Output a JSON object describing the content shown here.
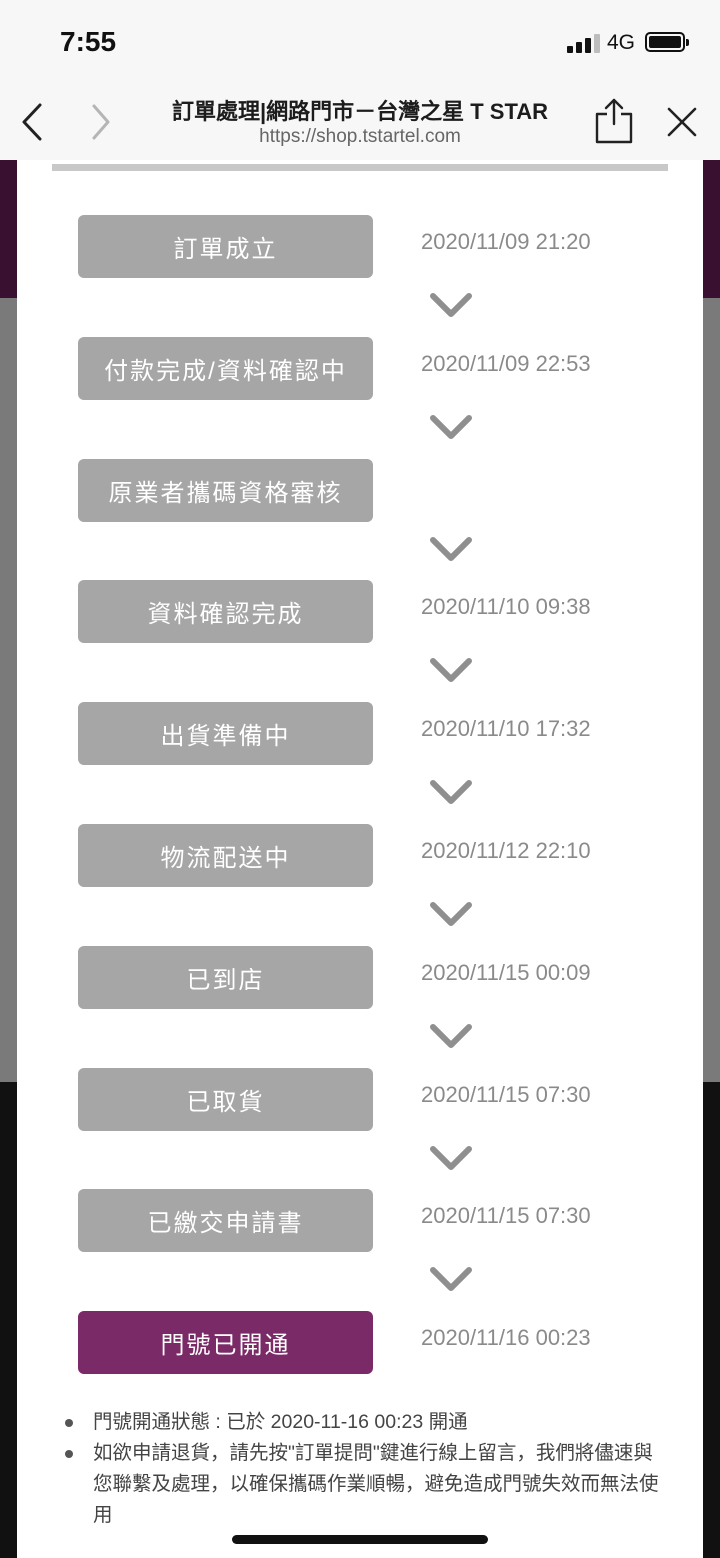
{
  "status_bar": {
    "time": "7:55",
    "network": "4G"
  },
  "browser": {
    "title": "訂單處理|網路門市－台灣之星 T STAR",
    "url": "https://shop.tstartel.com",
    "icons": [
      "chevron-left-icon",
      "chevron-right-icon",
      "share-icon",
      "close-icon"
    ]
  },
  "timeline": {
    "steps": [
      {
        "label": "訂單成立",
        "time": "2020/11/09 21:20"
      },
      {
        "label": "付款完成/資料確認中",
        "time": "2020/11/09 22:53"
      },
      {
        "label": "原業者攜碼資格審核",
        "time": ""
      },
      {
        "label": "資料確認完成",
        "time": "2020/11/10 09:38"
      },
      {
        "label": "出貨準備中",
        "time": "2020/11/10 17:32"
      },
      {
        "label": "物流配送中",
        "time": "2020/11/12 22:10"
      },
      {
        "label": "已到店",
        "time": "2020/11/15 00:09"
      },
      {
        "label": "已取貨",
        "time": "2020/11/15 07:30"
      },
      {
        "label": "已繳交申請書",
        "time": "2020/11/15 07:30"
      },
      {
        "label": "門號已開通",
        "time": "2020/11/16 00:23"
      }
    ],
    "active_step_index": 9,
    "colors": {
      "step_default": "#a6a6a6",
      "step_active": "#7a2a67",
      "time_text": "#8a8a8a",
      "chevron": "#8f8f8f"
    }
  },
  "notes": [
    "門號開通狀態 : 已於 2020-11-16 00:23 開通",
    "如欲申請退貨，請先按\"訂單提問\"鍵進行線上留言，我們將儘速與您聯繫及處理，以確保攜碼作業順暢，避免造成門號失效而無法使用"
  ]
}
